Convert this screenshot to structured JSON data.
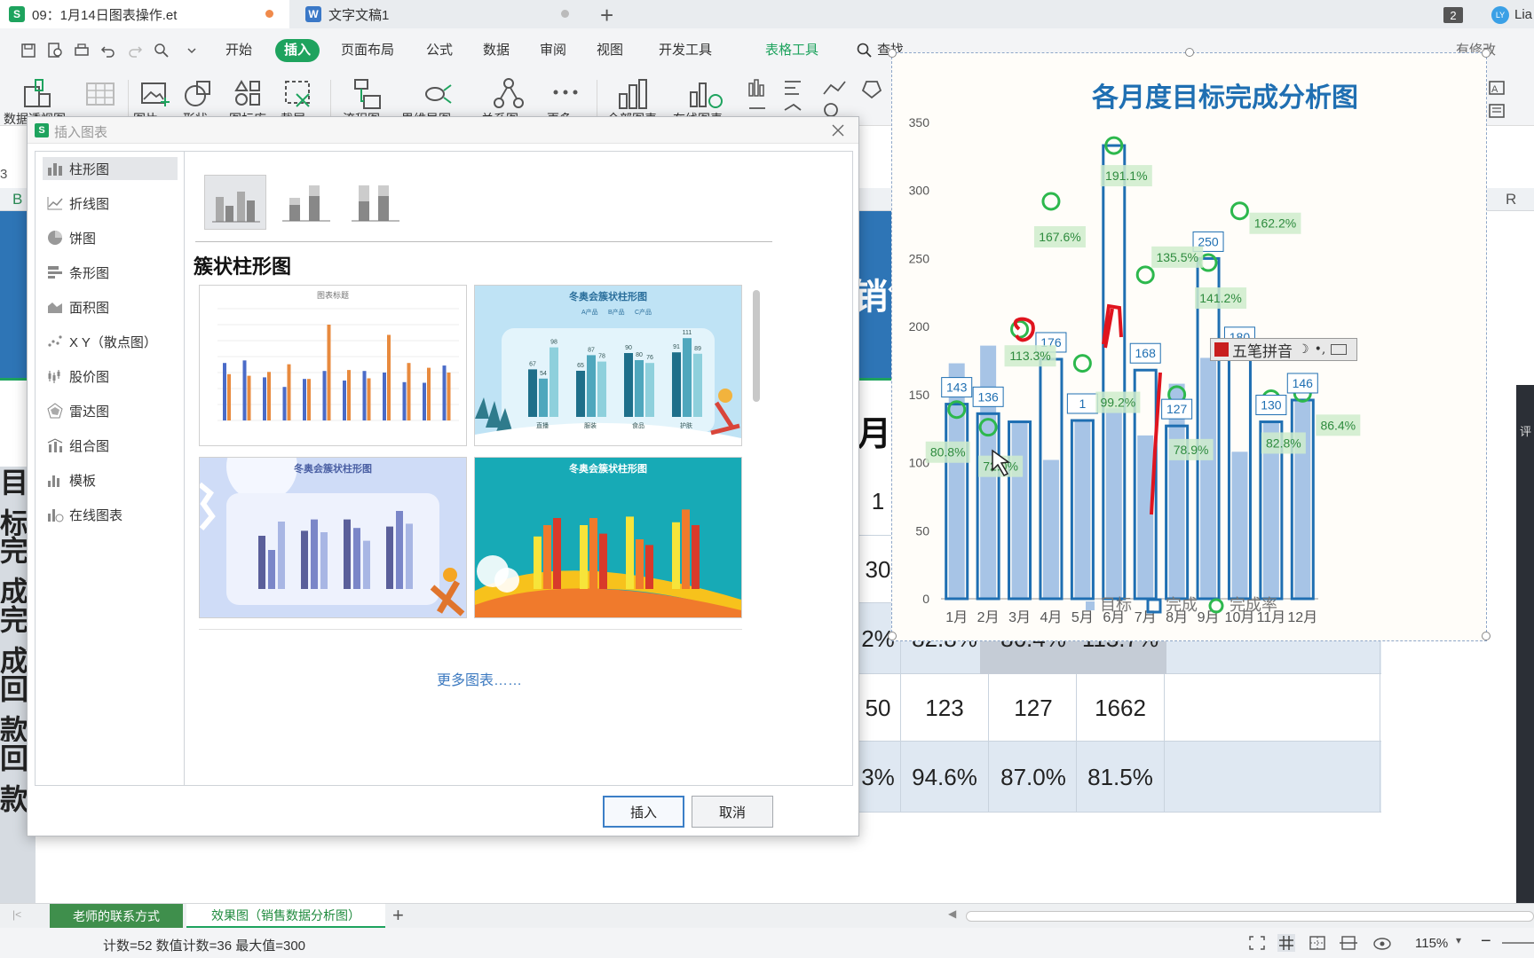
{
  "tabs": [
    {
      "badge": "S",
      "title": "09：1月14日图表操作.et",
      "badge_color": "#1ea35e"
    },
    {
      "badge": "W",
      "title": "文字文稿1",
      "badge_color": "#3a78c7"
    }
  ],
  "window": {
    "count_badge": "2",
    "avatar": "LY",
    "user": "Lia"
  },
  "menu": {
    "items": [
      "开始",
      "插入",
      "页面布局",
      "公式",
      "数据",
      "审阅",
      "视图",
      "开发工具"
    ],
    "active": "插入",
    "context_tab": "表格工具",
    "search": "查找",
    "right_action": "有修改"
  },
  "ribbon": {
    "labels": [
      "数据透视图",
      "图片",
      "形状",
      "图标库",
      "截屏",
      "流程图",
      "思维导图",
      "关系图",
      "更多",
      "全部图表",
      "在线图表"
    ]
  },
  "sheet": {
    "formula_row_label": "3",
    "col_b": "B",
    "col_r": "R",
    "title_fragment": "销售",
    "header_fragment": "月",
    "row_labels": [
      "目标",
      "完成",
      "完成",
      "回款",
      "回款"
    ],
    "row_values": [
      [
        "1",
        "",
        "",
        ""
      ],
      [
        "30",
        "",
        "",
        ""
      ],
      [
        "2%",
        "82.8%",
        "86.4%",
        "113.7%"
      ],
      [
        "50",
        "123",
        "127",
        "1662"
      ],
      [
        "3%",
        "94.6%",
        "87.0%",
        "81.5%"
      ]
    ],
    "right_panel_fragment": "评"
  },
  "dialog": {
    "title": "插入图表",
    "categories": [
      "柱形图",
      "折线图",
      "饼图",
      "条形图",
      "面积图",
      "X Y（散点图）",
      "股价图",
      "雷达图",
      "组合图",
      "模板",
      "在线图表"
    ],
    "selected_category": "柱形图",
    "section_title": "簇状柱形图",
    "template_titles": [
      "图表标题",
      "冬奥会簇状柱形图",
      "冬奥会簇状柱形图",
      "冬奥会簇状柱形图"
    ],
    "template_legends": [
      "A产品",
      "B产品",
      "C产品"
    ],
    "blue_categories": [
      "直播",
      "服装",
      "食品",
      "护肤"
    ],
    "blue_values": [
      [
        67,
        54,
        98
      ],
      [
        65,
        87,
        78
      ],
      [
        90,
        80,
        76
      ],
      [
        91,
        111,
        89
      ]
    ],
    "more_link": "更多图表……",
    "ok": "插入",
    "cancel": "取消"
  },
  "ime": {
    "text": "五笔拼音"
  },
  "chart_data": {
    "type": "bar",
    "title": "各月度目标完成分析图",
    "categories": [
      "1月",
      "2月",
      "3月",
      "4月",
      "5月",
      "6月",
      "7月",
      "8月",
      "9月",
      "10月",
      "11月",
      "12月"
    ],
    "ylim": [
      0,
      350
    ],
    "yticks": [
      0,
      50,
      100,
      150,
      200,
      250,
      300,
      350
    ],
    "series": [
      {
        "name": "目标",
        "values": [
          173,
          186,
          131,
          102,
          130,
          140,
          120,
          158,
          177,
          108,
          130,
          147
        ]
      },
      {
        "name": "完成",
        "values": [
          143,
          136,
          130,
          176,
          131,
          333,
          168,
          127,
          250,
          180,
          130,
          146
        ]
      },
      {
        "name": "完成率",
        "values": [
          139,
          126,
          198,
          292,
          173,
          333,
          238,
          150,
          247,
          285,
          147,
          151
        ]
      }
    ],
    "bar_labels": [
      "143",
      "136",
      "",
      "176",
      "1",
      "",
      "168",
      "127",
      "250",
      "180",
      "130",
      "146"
    ],
    "rate_labels": [
      "80.8%",
      "72.0%",
      "113.3%",
      "167.6%",
      "99.2%",
      "191.1%",
      "135.5%",
      "78.9%",
      "141.2%",
      "162.2%",
      "82.8%",
      "86.4%"
    ],
    "legend_position": "bottom",
    "colors": {
      "target": "#a7c4e6",
      "done": "#1f6fb2",
      "rate": "#2db84d",
      "title": "#1f6fb2",
      "label_bg": "#cfeccc",
      "label_text": "#2e8b3e"
    }
  },
  "sheet_tabs": [
    "老师的联系方式",
    "效果图（销售数据分析图）"
  ],
  "status": {
    "text": "计数=52  数值计数=36  最大值=300",
    "zoom": "115%"
  }
}
